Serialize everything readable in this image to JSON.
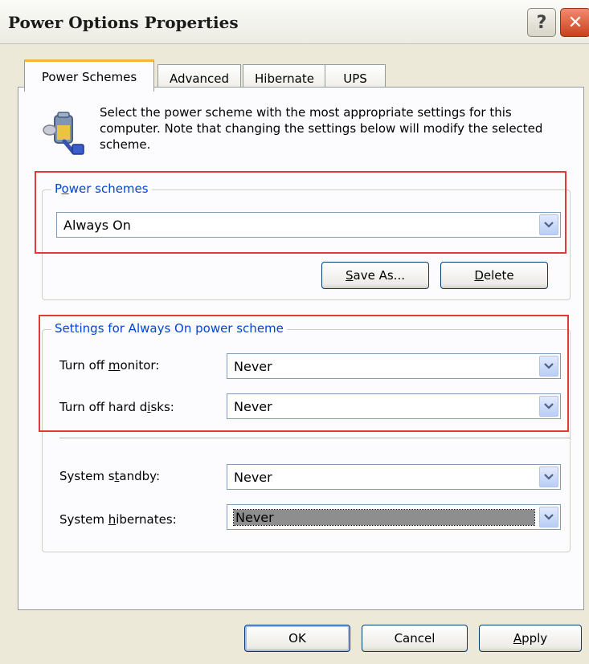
{
  "window": {
    "title": "Power Options Properties"
  },
  "tabs": [
    {
      "label": "Power Schemes"
    },
    {
      "label": "Advanced"
    },
    {
      "label": "Hibernate"
    },
    {
      "label": "UPS"
    }
  ],
  "intro_text": "Select the power scheme with the most appropriate settings for this computer. Note that changing the settings below will modify the selected scheme.",
  "power_schemes": {
    "label_pre": "P",
    "label_ul": "o",
    "label_post": "wer schemes",
    "selected": "Always On",
    "save_as_ul": "S",
    "save_as_post": "ave As...",
    "delete_ul": "D",
    "delete_post": "elete"
  },
  "settings": {
    "group_label": "Settings for Always On power scheme",
    "monitor": {
      "label_pre": "Turn off ",
      "label_ul": "m",
      "label_post": "onitor:",
      "value": "Never"
    },
    "hard_disks": {
      "label_pre": "Turn off hard d",
      "label_ul": "i",
      "label_post": "sks:",
      "value": "Never"
    },
    "standby": {
      "label_pre": "System s",
      "label_ul": "t",
      "label_post": "andby:",
      "value": "Never"
    },
    "hibernates": {
      "label_pre": "System ",
      "label_ul": "h",
      "label_post": "ibernates:",
      "value": "Never"
    }
  },
  "buttons": {
    "ok": "OK",
    "cancel": "Cancel",
    "apply_ul": "A",
    "apply_post": "pply"
  },
  "colors": {
    "highlight_box": "#e23a3a",
    "group_label": "#0046d5",
    "active_tab_accent": "#f8b33c"
  }
}
